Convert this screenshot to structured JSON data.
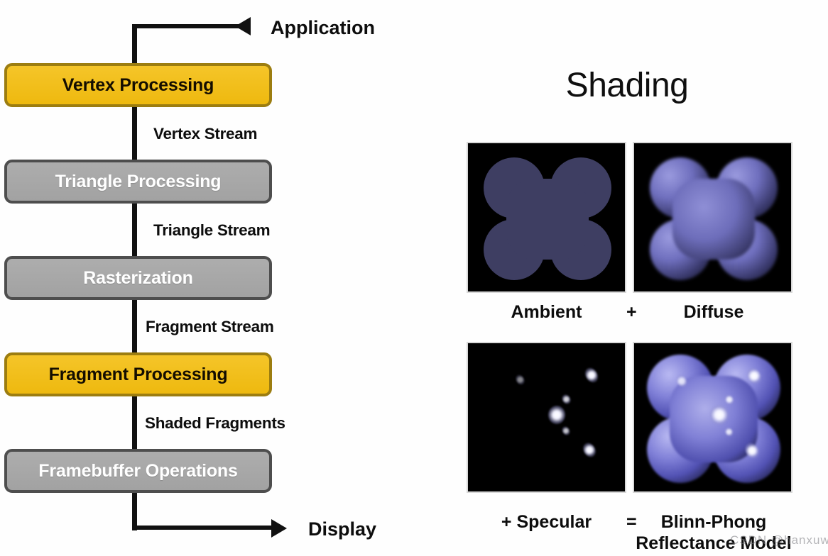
{
  "pipeline": {
    "top_connector_label": "Application",
    "bottom_connector_label": "Display",
    "stages": [
      {
        "label": "Vertex Processing",
        "style": "yellow"
      },
      {
        "label": "Triangle Processing",
        "style": "gray"
      },
      {
        "label": "Rasterization",
        "style": "gray"
      },
      {
        "label": "Fragment Processing",
        "style": "yellow"
      },
      {
        "label": "Framebuffer Operations",
        "style": "gray"
      }
    ],
    "edge_labels": [
      "Vertex Stream",
      "Triangle Stream",
      "Fragment Stream",
      "Shaded Fragments"
    ],
    "colors": {
      "highlight_fill": "#f0bf1b",
      "highlight_border": "#9c7d10",
      "stage_fill": "#a8a8a8",
      "stage_border": "#4e4e4e",
      "spine": "#111111"
    }
  },
  "shading": {
    "title": "Shading",
    "thumbnails": [
      {
        "name": "ambient",
        "caption": "Ambient"
      },
      {
        "name": "diffuse",
        "caption": "Diffuse"
      },
      {
        "name": "specular",
        "caption": "+ Specular"
      },
      {
        "name": "blinn",
        "caption": "Blinn-Phong"
      }
    ],
    "caption_top": {
      "left": "Ambient",
      "operator": "+",
      "right": "Diffuse"
    },
    "caption_bottom": {
      "left": "+ Specular",
      "operator": "=",
      "right_line1": "Blinn-Phong",
      "right_line2": "Reflectance Model"
    },
    "colors": {
      "ambient_fill": "#3e3e62",
      "diffuse_fill": "#7b7bc8",
      "blinn_fill": "#8181d8",
      "specular_highlight": "#ffffff",
      "thumb_background": "#000000"
    }
  },
  "watermark": {
    "text": "CSDN @hanxuwu"
  }
}
